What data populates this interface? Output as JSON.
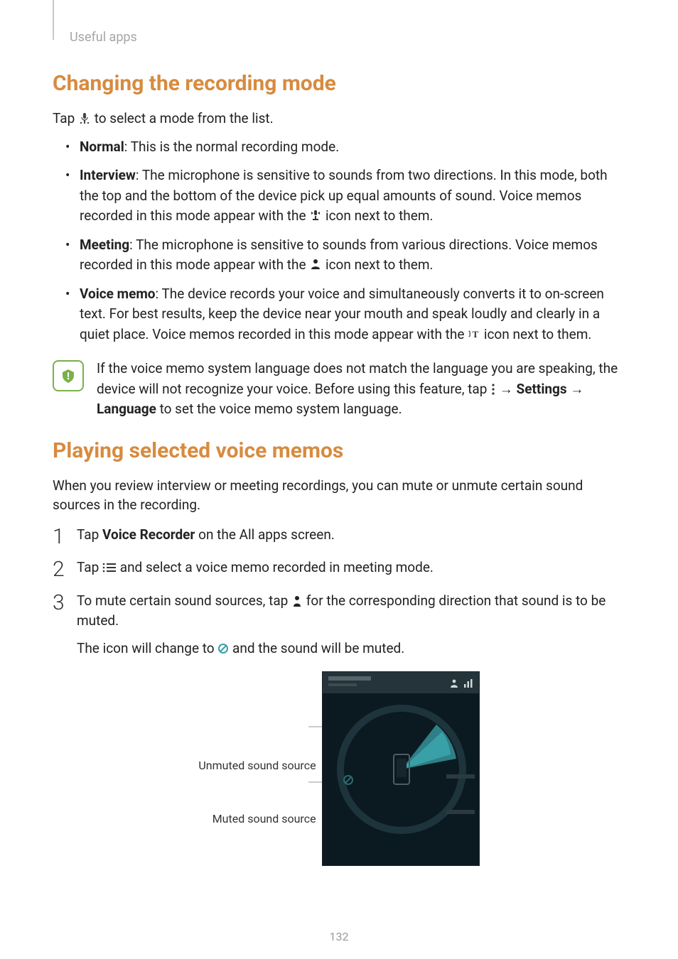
{
  "breadcrumb": "Useful apps",
  "sections": {
    "changing": {
      "title": "Changing the recording mode",
      "intro_pre": "Tap ",
      "intro_post": " to select a mode from the list.",
      "bullets": {
        "normal": {
          "label": "Normal",
          "text": ": This is the normal recording mode."
        },
        "interview": {
          "label": "Interview",
          "text_a": ": The microphone is sensitive to sounds from two directions. In this mode, both the top and the bottom of the device pick up equal amounts of sound. Voice memos recorded in this mode appear with the ",
          "text_b": " icon next to them."
        },
        "meeting": {
          "label": "Meeting",
          "text_a": ": The microphone is sensitive to sounds from various directions. Voice memos recorded in this mode appear with the ",
          "text_b": " icon next to them."
        },
        "voicememo": {
          "label": "Voice memo",
          "text_a": ": The device records your voice and simultaneously converts it to on-screen text. For best results, keep the device near your mouth and speak loudly and clearly in a quiet place. Voice memos recorded in this mode appear with the ",
          "text_b": " icon next to them."
        }
      },
      "note": {
        "a": "If the voice memo system language does not match the language you are speaking, the device will not recognize your voice. Before using this feature, tap ",
        "arrow1": " → ",
        "settings": "Settings",
        "arrow2": " → ",
        "language": "Language",
        "b": " to set the voice memo system language."
      }
    },
    "playing": {
      "title": "Playing selected voice memos",
      "intro": "When you review interview or meeting recordings, you can mute or unmute certain sound sources in the recording.",
      "steps": {
        "s1_a": "Tap ",
        "s1_b": "Voice Recorder",
        "s1_c": " on the All apps screen.",
        "s2_a": "Tap ",
        "s2_b": " and select a voice memo recorded in meeting mode.",
        "s3_a": "To mute certain sound sources, tap ",
        "s3_b": " for the corresponding direction that sound is to be muted.",
        "s3_c_a": "The icon will change to ",
        "s3_c_b": " and the sound will be muted."
      },
      "figure": {
        "label_unmuted": "Unmuted sound source",
        "label_muted": "Muted sound source"
      }
    }
  },
  "page_number": "132"
}
